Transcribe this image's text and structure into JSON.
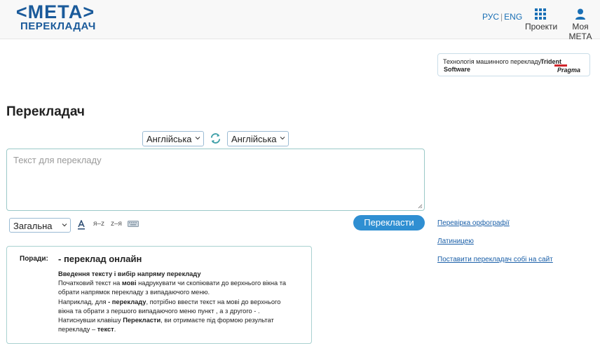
{
  "header": {
    "logo_main": "<МЕТА>",
    "logo_sub": "ПЕРЕКЛАДАЧ",
    "lang_ru": "РУС",
    "lang_sep": "|",
    "lang_en": "ENG",
    "nav_projects": "Проекти",
    "nav_account": "Моя МЕТА"
  },
  "sponsor": {
    "text": "Технологія машинного перекладу",
    "brand_trident": "Trident",
    "brand_software": "Software",
    "brand_pragma": "Pragma"
  },
  "page": {
    "title": "Перекладач"
  },
  "translator": {
    "source_lang": "Англійська",
    "target_lang": "Англійська",
    "input_placeholder": "Текст для  перекладу",
    "topic": "Загальна",
    "sort_az": "я–z",
    "sort_za": "z–я",
    "translate_label": "Перекласти"
  },
  "side_links": {
    "spellcheck": "Перевірка орфографії",
    "latin": "Латиницею",
    "embed": "Поставити перекладач собі на сайт"
  },
  "tips": {
    "label": "Поради:",
    "title": "- переклад онлайн",
    "heading": "Введення тексту і вибір напряму перекладу",
    "p1_a": "Початковий текст на ",
    "p1_b": "мові",
    "p1_c": " надрукувати чи скопіювати до верхнього вікна та обрати напрямок перекладу з випадаючого меню.",
    "p2_a": "Наприклад, для ",
    "p2_b": "- перекладу",
    "p2_c": ", потрібно ввести текст на мові до верхнього вікна та обрати з першого випадаючого меню пункт , а з другого - .",
    "p3_a": "Натиснувши клавішу ",
    "p3_b": "Перекласти",
    "p3_c": ", ви отримаєте під формою результат перекладу – ",
    "p3_d": "текст",
    "p3_e": "."
  },
  "colors": {
    "brand": "#1a5a9a",
    "accent": "#2f8fd2",
    "link": "#1a5fa8"
  }
}
